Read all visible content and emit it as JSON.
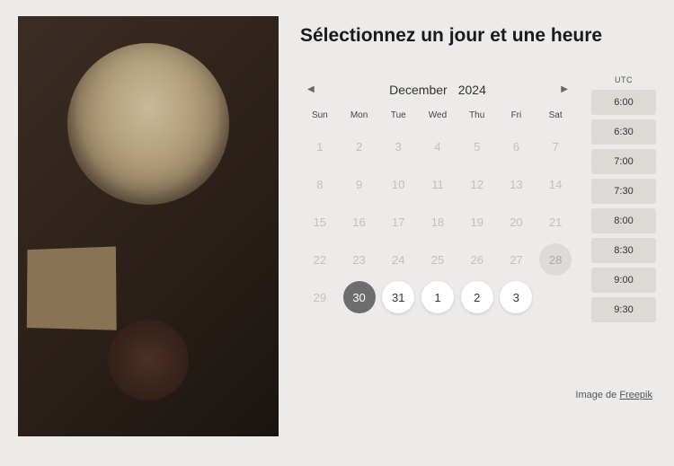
{
  "heading": "Sélectionnez un jour et une heure",
  "calendar": {
    "month": "December",
    "year": "2024",
    "dow": [
      "Sun",
      "Mon",
      "Tue",
      "Wed",
      "Thu",
      "Fri",
      "Sat"
    ],
    "days": [
      {
        "n": "1",
        "state": "disabled"
      },
      {
        "n": "2",
        "state": "disabled"
      },
      {
        "n": "3",
        "state": "disabled"
      },
      {
        "n": "4",
        "state": "disabled"
      },
      {
        "n": "5",
        "state": "disabled"
      },
      {
        "n": "6",
        "state": "disabled"
      },
      {
        "n": "7",
        "state": "disabled"
      },
      {
        "n": "8",
        "state": "disabled"
      },
      {
        "n": "9",
        "state": "disabled"
      },
      {
        "n": "10",
        "state": "disabled"
      },
      {
        "n": "11",
        "state": "disabled"
      },
      {
        "n": "12",
        "state": "disabled"
      },
      {
        "n": "13",
        "state": "disabled"
      },
      {
        "n": "14",
        "state": "disabled"
      },
      {
        "n": "15",
        "state": "disabled"
      },
      {
        "n": "16",
        "state": "disabled"
      },
      {
        "n": "17",
        "state": "disabled"
      },
      {
        "n": "18",
        "state": "disabled"
      },
      {
        "n": "19",
        "state": "disabled"
      },
      {
        "n": "20",
        "state": "disabled"
      },
      {
        "n": "21",
        "state": "disabled"
      },
      {
        "n": "22",
        "state": "disabled"
      },
      {
        "n": "23",
        "state": "disabled"
      },
      {
        "n": "24",
        "state": "disabled"
      },
      {
        "n": "25",
        "state": "disabled"
      },
      {
        "n": "26",
        "state": "disabled"
      },
      {
        "n": "27",
        "state": "disabled"
      },
      {
        "n": "28",
        "state": "today-hint"
      },
      {
        "n": "29",
        "state": "disabled"
      },
      {
        "n": "30",
        "state": "selected"
      },
      {
        "n": "31",
        "state": "available"
      },
      {
        "n": "1",
        "state": "available"
      },
      {
        "n": "2",
        "state": "available"
      },
      {
        "n": "3",
        "state": "available"
      }
    ]
  },
  "timezone_label": "UTC",
  "time_slots": [
    "6:00",
    "6:30",
    "7:00",
    "7:30",
    "8:00",
    "8:30",
    "9:00",
    "9:30"
  ],
  "credit": {
    "prefix": "Image de ",
    "link_text": "Freepik"
  }
}
